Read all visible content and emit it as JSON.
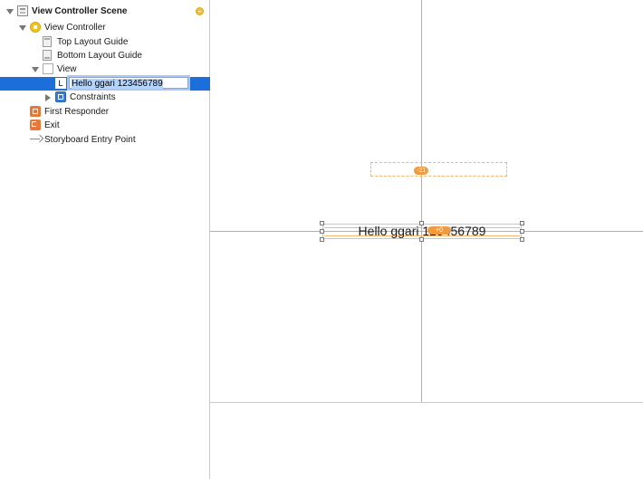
{
  "outline": {
    "scene": {
      "label": "View Controller Scene"
    },
    "view_controller": {
      "label": "View Controller"
    },
    "top_layout_guide": {
      "label": "Top Layout Guide"
    },
    "bottom_layout_guide": {
      "label": "Bottom Layout Guide"
    },
    "view": {
      "label": "View"
    },
    "label_item": {
      "icon_letter": "L",
      "edit_value": "Hello ggari 123456789"
    },
    "constraints": {
      "label": "Constraints"
    },
    "first_responder": {
      "label": "First Responder"
    },
    "exit": {
      "label": "Exit"
    },
    "entry_point": {
      "label": "Storyboard Entry Point"
    }
  },
  "canvas": {
    "label_text": "Hello ggari 123456789",
    "vertical_constraint_value": "-21",
    "center_constraint_value": "+0"
  },
  "colors": {
    "selection": "#1c6fdb",
    "guide": "#f5a24a",
    "constraint_badge": "#f19a3e"
  },
  "icons": {
    "scene": "scene-icon",
    "view_controller": "view-controller-icon",
    "layout_guide": "layout-guide-icon",
    "view": "view-icon",
    "label": "label-icon",
    "constraints": "constraints-icon",
    "first_responder": "first-responder-icon",
    "exit": "exit-icon",
    "entry_point": "arrow-right-icon"
  }
}
